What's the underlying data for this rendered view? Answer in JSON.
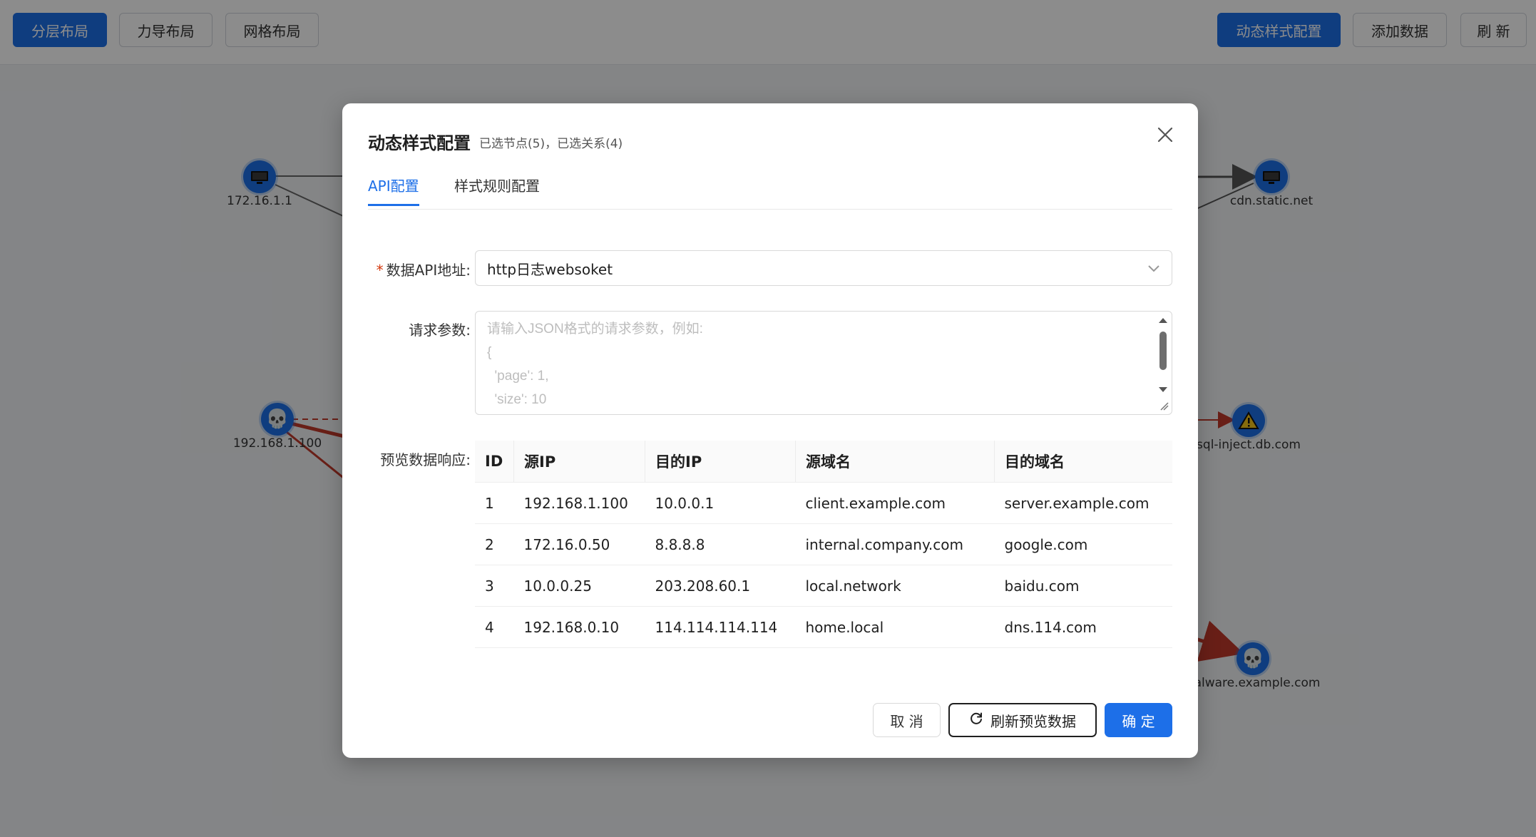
{
  "toolbar": {
    "layout_buttons": [
      "分层布局",
      "力导布局",
      "网格布局"
    ],
    "active_layout": "分层布局",
    "right_buttons": [
      "动态样式配置",
      "添加数据",
      "刷 新"
    ]
  },
  "graph": {
    "nodes": [
      {
        "label": "172.16.1.1",
        "icon": "monitor-icon"
      },
      {
        "label": "192.168.1.100",
        "icon": "skull-icon"
      },
      {
        "label": "cdn.static.net",
        "icon": "monitor-icon"
      },
      {
        "label": "sql-inject.db.com",
        "icon": "warning-icon"
      },
      {
        "label": "alware.example.com",
        "icon": "skull-icon"
      }
    ]
  },
  "modal": {
    "title": "动态样式配置",
    "subtitle": "已选节点(5)，已选关系(4)",
    "tabs": [
      "API配置",
      "样式规则配置"
    ],
    "active_tab": "API配置",
    "api_label": "数据API地址:",
    "api_value": "http日志websoket",
    "params_label": "请求参数:",
    "params_placeholder": "请输入JSON格式的请求参数，例如:\n{\n  'page': 1,\n  'size': 10",
    "preview_label": "预览数据响应:",
    "table": {
      "headers": [
        "ID",
        "源IP",
        "目的IP",
        "源域名",
        "目的域名"
      ],
      "rows": [
        [
          "1",
          "192.168.1.100",
          "10.0.0.1",
          "client.example.com",
          "server.example.com"
        ],
        [
          "2",
          "172.16.0.50",
          "8.8.8.8",
          "internal.company.com",
          "google.com"
        ],
        [
          "3",
          "10.0.0.25",
          "203.208.60.1",
          "local.network",
          "baidu.com"
        ],
        [
          "4",
          "192.168.0.10",
          "114.114.114.114",
          "home.local",
          "dns.114.com"
        ]
      ]
    },
    "cancel_label": "取 消",
    "refresh_label": "刷新预览数据",
    "ok_label": "确 定"
  },
  "colors": {
    "primary": "#1d6fe8",
    "danger_edge": "#c0392b",
    "required": "#d4380d"
  }
}
